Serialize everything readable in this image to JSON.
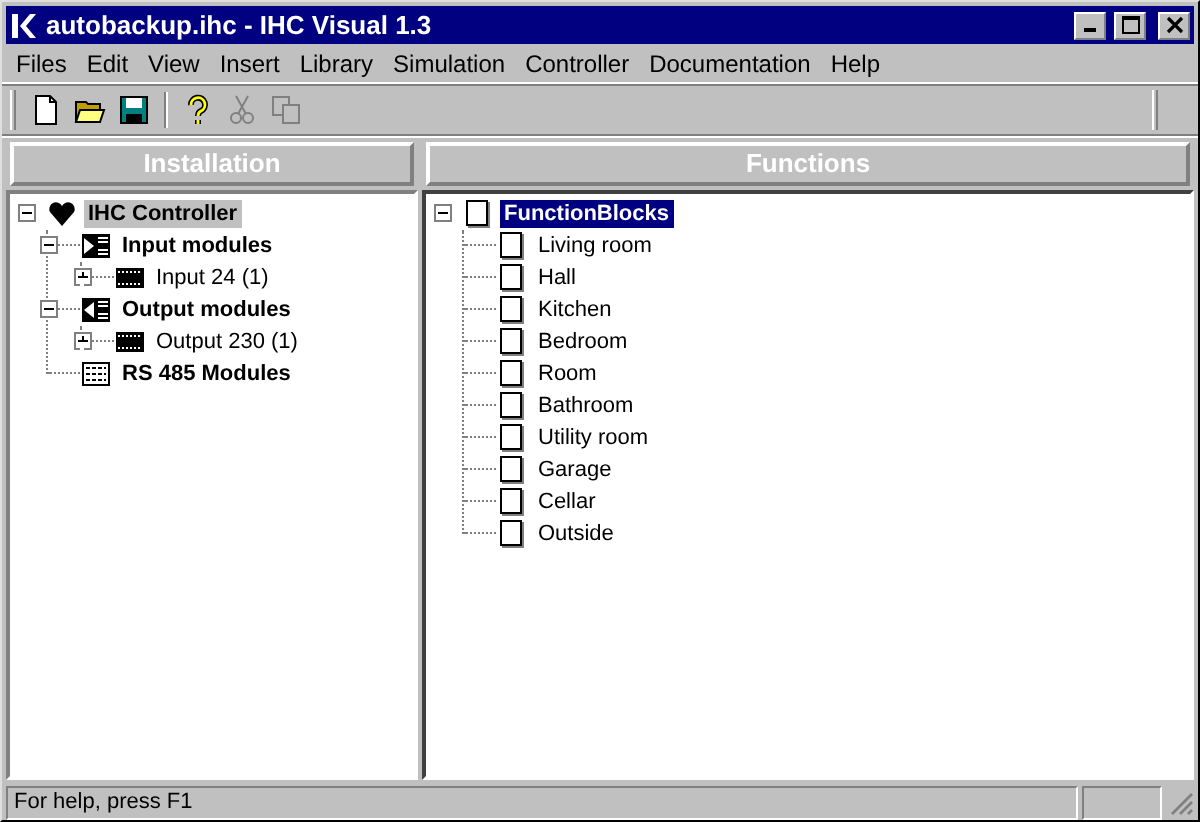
{
  "window": {
    "title": "autobackup.ihc - IHC Visual 1.3"
  },
  "menu": [
    "Files",
    "Edit",
    "View",
    "Insert",
    "Library",
    "Simulation",
    "Controller",
    "Documentation",
    "Help"
  ],
  "toolbar": [
    {
      "kind": "new",
      "disabled": false
    },
    {
      "kind": "open",
      "disabled": false
    },
    {
      "kind": "save",
      "disabled": false
    },
    {
      "kind": "separator"
    },
    {
      "kind": "help",
      "disabled": false
    },
    {
      "kind": "cut",
      "disabled": true
    },
    {
      "kind": "copy",
      "disabled": true
    }
  ],
  "installation": {
    "title": "Installation",
    "focused": false,
    "tree": [
      {
        "label": "IHC Controller",
        "kind": "controller",
        "bold": true,
        "expanded": true,
        "selected": true,
        "children": [
          {
            "label": "Input modules",
            "kind": "input",
            "bold": true,
            "expanded": true,
            "selected": false,
            "children": [
              {
                "label": "Input 24 (1)",
                "kind": "module",
                "bold": false,
                "expanded": false,
                "selected": false
              }
            ]
          },
          {
            "label": "Output modules",
            "kind": "output",
            "bold": true,
            "expanded": true,
            "selected": false,
            "children": [
              {
                "label": "Output 230 (1)",
                "kind": "module",
                "bold": false,
                "expanded": false,
                "selected": false
              }
            ]
          },
          {
            "label": "RS 485 Modules",
            "kind": "bus",
            "bold": true,
            "selected": false
          }
        ]
      }
    ]
  },
  "functions": {
    "title": "Functions",
    "focused": true,
    "tree": [
      {
        "label": "FunctionBlocks",
        "kind": "page",
        "bold": true,
        "expanded": true,
        "selected": true,
        "children": [
          {
            "label": "Living room",
            "kind": "page",
            "bold": false,
            "selected": false
          },
          {
            "label": "Hall",
            "kind": "page",
            "bold": false,
            "selected": false
          },
          {
            "label": "Kitchen",
            "kind": "page",
            "bold": false,
            "selected": false
          },
          {
            "label": "Bedroom",
            "kind": "page",
            "bold": false,
            "selected": false
          },
          {
            "label": "Room",
            "kind": "page",
            "bold": false,
            "selected": false
          },
          {
            "label": "Bathroom",
            "kind": "page",
            "bold": false,
            "selected": false
          },
          {
            "label": "Utility room",
            "kind": "page",
            "bold": false,
            "selected": false
          },
          {
            "label": "Garage",
            "kind": "page",
            "bold": false,
            "selected": false
          },
          {
            "label": "Cellar",
            "kind": "page",
            "bold": false,
            "selected": false
          },
          {
            "label": "Outside",
            "kind": "page",
            "bold": false,
            "selected": false
          }
        ]
      }
    ]
  },
  "status_bar": {
    "text": "For help, press F1"
  }
}
